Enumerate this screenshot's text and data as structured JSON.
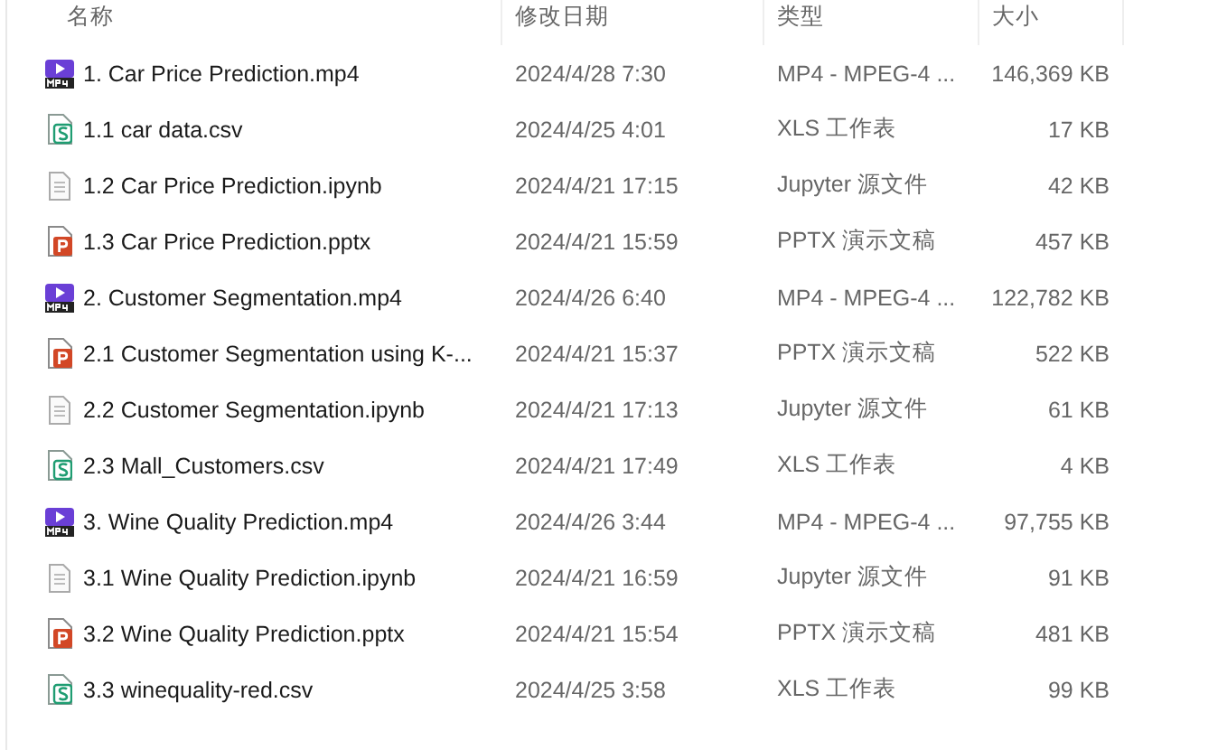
{
  "columns": [
    "名称",
    "修改日期",
    "类型",
    "大小"
  ],
  "files": [
    {
      "kind": "video",
      "name": "1. Car Price Prediction.mp4",
      "modified": "2024/4/28 7:30",
      "type": "MP4 - MPEG-4 ...",
      "size": "146,369 KB"
    },
    {
      "kind": "sheet",
      "name": "1.1 car data.csv",
      "modified": "2024/4/25 4:01",
      "type": "XLS 工作表",
      "size": "17 KB"
    },
    {
      "kind": "text",
      "name": "1.2 Car Price Prediction.ipynb",
      "modified": "2024/4/21 17:15",
      "type": "Jupyter 源文件",
      "size": "42 KB"
    },
    {
      "kind": "slides",
      "name": "1.3 Car Price Prediction.pptx",
      "modified": "2024/4/21 15:59",
      "type": "PPTX 演示文稿",
      "size": "457 KB"
    },
    {
      "kind": "video",
      "name": "2. Customer Segmentation.mp4",
      "modified": "2024/4/26 6:40",
      "type": "MP4 - MPEG-4 ...",
      "size": "122,782 KB"
    },
    {
      "kind": "slides",
      "name": "2.1 Customer Segmentation using K-...",
      "modified": "2024/4/21 15:37",
      "type": "PPTX 演示文稿",
      "size": "522 KB"
    },
    {
      "kind": "text",
      "name": "2.2 Customer Segmentation.ipynb",
      "modified": "2024/4/21 17:13",
      "type": "Jupyter 源文件",
      "size": "61 KB"
    },
    {
      "kind": "sheet",
      "name": "2.3 Mall_Customers.csv",
      "modified": "2024/4/21 17:49",
      "type": "XLS 工作表",
      "size": "4 KB"
    },
    {
      "kind": "video",
      "name": "3. Wine Quality Prediction.mp4",
      "modified": "2024/4/26 3:44",
      "type": "MP4 - MPEG-4 ...",
      "size": "97,755 KB"
    },
    {
      "kind": "text",
      "name": "3.1 Wine Quality Prediction.ipynb",
      "modified": "2024/4/21 16:59",
      "type": "Jupyter 源文件",
      "size": "91 KB"
    },
    {
      "kind": "slides",
      "name": "3.2 Wine Quality Prediction.pptx",
      "modified": "2024/4/21 15:54",
      "type": "PPTX 演示文稿",
      "size": "481 KB"
    },
    {
      "kind": "sheet",
      "name": "3.3 winequality-red.csv",
      "modified": "2024/4/25 3:58",
      "type": "XLS 工作表",
      "size": "99 KB"
    }
  ]
}
